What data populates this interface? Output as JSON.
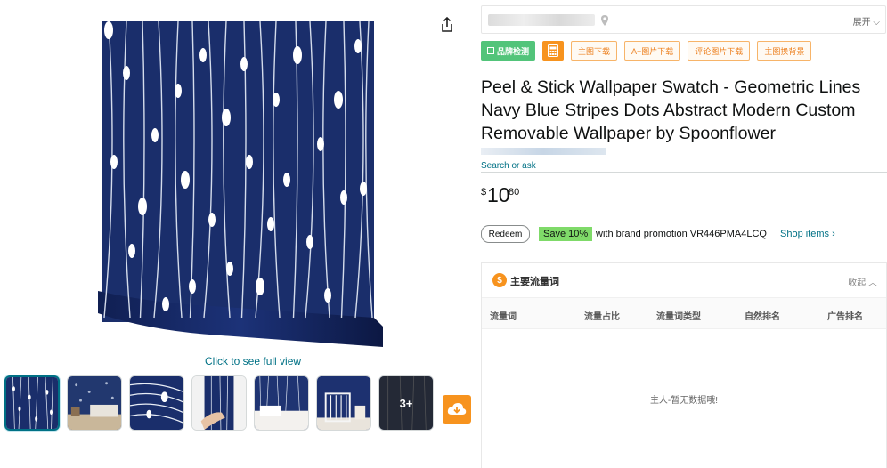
{
  "colors": {
    "navy": "#1a2e6b",
    "link": "#007185",
    "accent_orange": "#f7931e",
    "save_badge": "#7fda69",
    "tool_green": "#52c47a"
  },
  "icons": {
    "share": "share-icon",
    "cloud": "cloud-download-icon",
    "location": "location-pin-icon",
    "calculator": "calculator-icon",
    "brand_logo": "dollar-circle-icon"
  },
  "gallery": {
    "full_view_label": "Click to see full view",
    "more_label": "3+",
    "thumbnails": [
      "pattern-swatch",
      "bedroom-scene",
      "wave-closeup",
      "hand-peel",
      "hallway-wall",
      "crib-room",
      "more-images"
    ]
  },
  "extension": {
    "expand_label": "展开",
    "tools": [
      "品牌检测",
      "主图下载",
      "A+图片下载",
      "评论图片下载",
      "主图换背景"
    ]
  },
  "product": {
    "title": "Peel & Stick Wallpaper Swatch - Geometric Lines Navy Blue Stripes Dots Abstract Modern Custom Removable Wallpaper by Spoonflower",
    "search_ask": "Search or ask",
    "price_symbol": "$",
    "price_whole": "10",
    "price_fraction": "80"
  },
  "promo": {
    "redeem_label": "Redeem",
    "save_label": "Save 10%",
    "text": "with brand promotion VR446PMA4LCQ",
    "shop_items_label": "Shop items ›"
  },
  "keyword_panel": {
    "title": "主要流量词",
    "collapse_label": "收起",
    "columns": [
      "流量词",
      "流量占比",
      "流量词类型",
      "自然排名",
      "广告排名"
    ],
    "empty_text": "主人-暂无数据哦!"
  }
}
